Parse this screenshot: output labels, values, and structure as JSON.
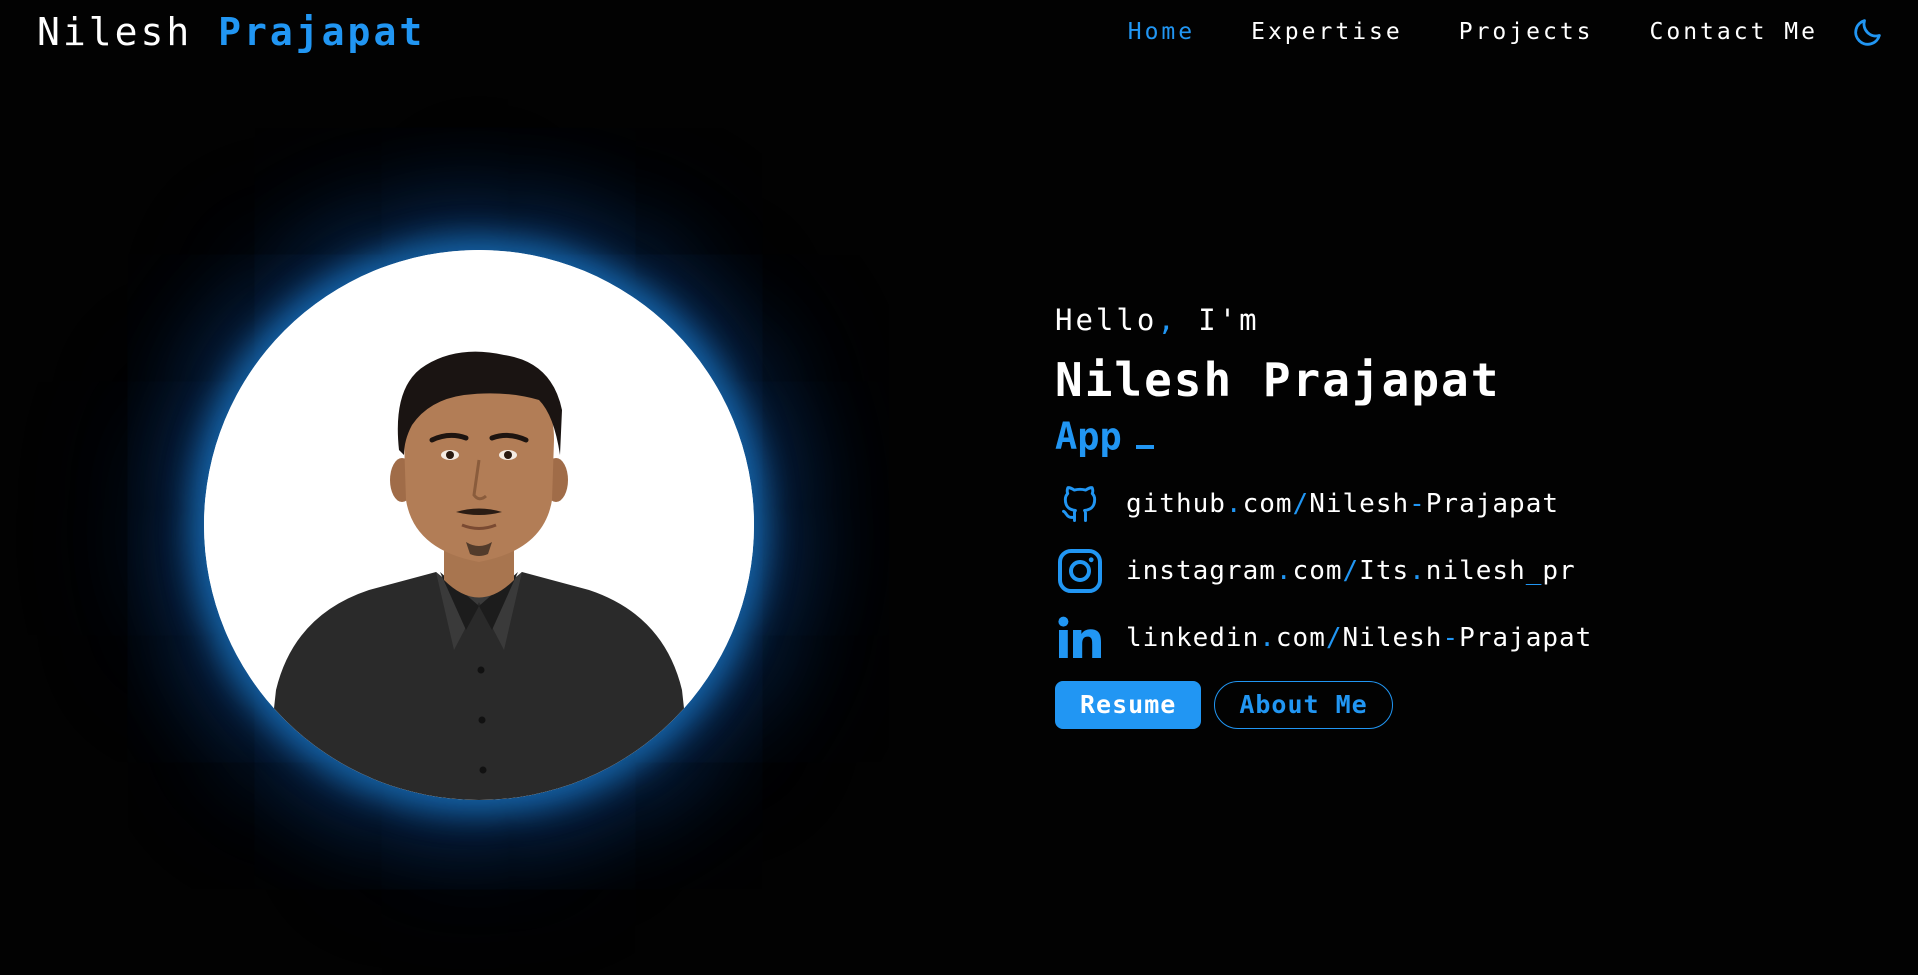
{
  "header": {
    "logo_first": "Nilesh",
    "logo_last": "Prajapat",
    "nav": [
      {
        "label": "Home",
        "active": true
      },
      {
        "label": "Expertise",
        "active": false
      },
      {
        "label": "Projects",
        "active": false
      },
      {
        "label": "Contact Me",
        "active": false
      }
    ],
    "theme_toggle_icon": "moon-icon"
  },
  "hero": {
    "greeting_word": "Hello",
    "greeting_comma": ",",
    "greeting_rest": " I'm",
    "name": "Nilesh Prajapat",
    "typed_role": "App",
    "socials": [
      {
        "icon": "github-icon",
        "parts": [
          "github",
          ".",
          "com",
          "/",
          "Nilesh",
          "-",
          "Prajapat"
        ]
      },
      {
        "icon": "instagram-icon",
        "parts": [
          "instagram",
          ".",
          "com",
          "/",
          "Its",
          ".",
          "nilesh",
          "_",
          "pr"
        ]
      },
      {
        "icon": "linkedin-icon",
        "parts": [
          "linkedin",
          ".",
          "com",
          "/",
          "Nilesh",
          "-",
          "Prajapat"
        ]
      }
    ],
    "buttons": {
      "resume_label": "Resume",
      "about_label": "About Me"
    }
  },
  "colors": {
    "background": "#020202",
    "accent": "#2196f3",
    "text": "#ffffff"
  }
}
